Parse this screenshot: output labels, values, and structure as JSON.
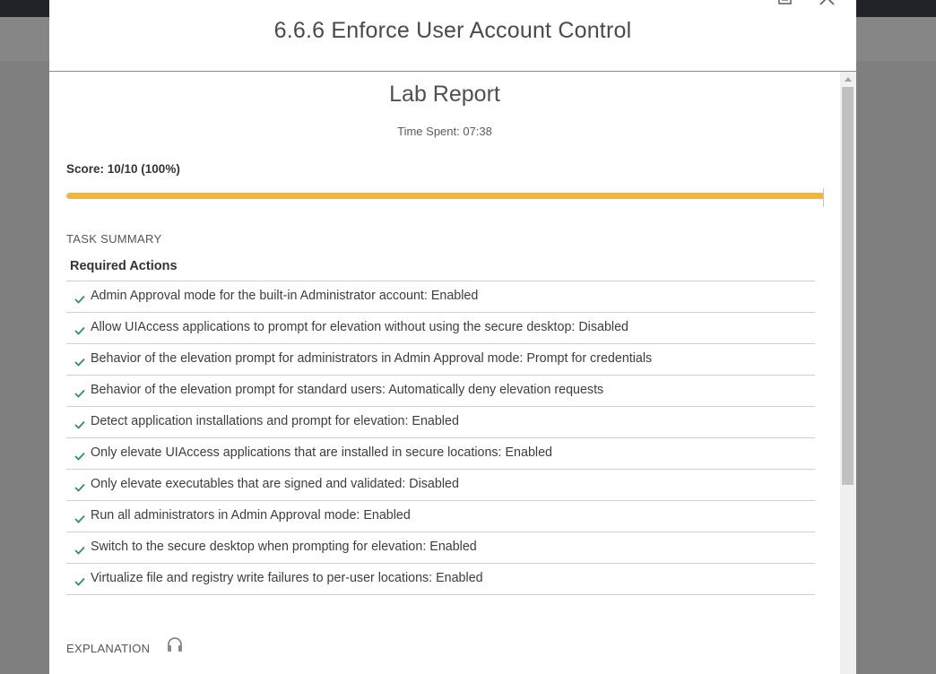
{
  "modal": {
    "title": "6.6.6 Enforce User Account Control"
  },
  "report": {
    "title": "Lab Report",
    "time_spent": "Time Spent: 07:38",
    "score": "Score: 10/10 (100%)",
    "progress_fraction": 1.0,
    "accent_color": "#f7b531"
  },
  "task_summary": {
    "label": "TASK SUMMARY",
    "required_label": "Required Actions",
    "items": [
      "Admin Approval mode for the built-in Administrator account: Enabled",
      "Allow UIAccess applications to prompt for elevation without using the secure desktop: Disabled",
      "Behavior of the elevation prompt for administrators in Admin Approval mode: Prompt for credentials",
      "Behavior of the elevation prompt for standard users: Automatically deny elevation requests",
      "Detect application installations and prompt for elevation: Enabled",
      "Only elevate UIAccess applications that are installed in secure locations: Enabled",
      "Only elevate executables that are signed and validated: Disabled",
      "Run all administrators in Admin Approval mode: Enabled",
      "Switch to the secure desktop when prompting for elevation: Enabled",
      "Virtualize file and registry write failures to per-user locations: Enabled"
    ]
  },
  "explanation": {
    "label": "EXPLANATION",
    "icon": "headphones-icon"
  },
  "icons": {
    "print": "print-icon",
    "close": "close-icon",
    "check": "checkmark-icon"
  }
}
